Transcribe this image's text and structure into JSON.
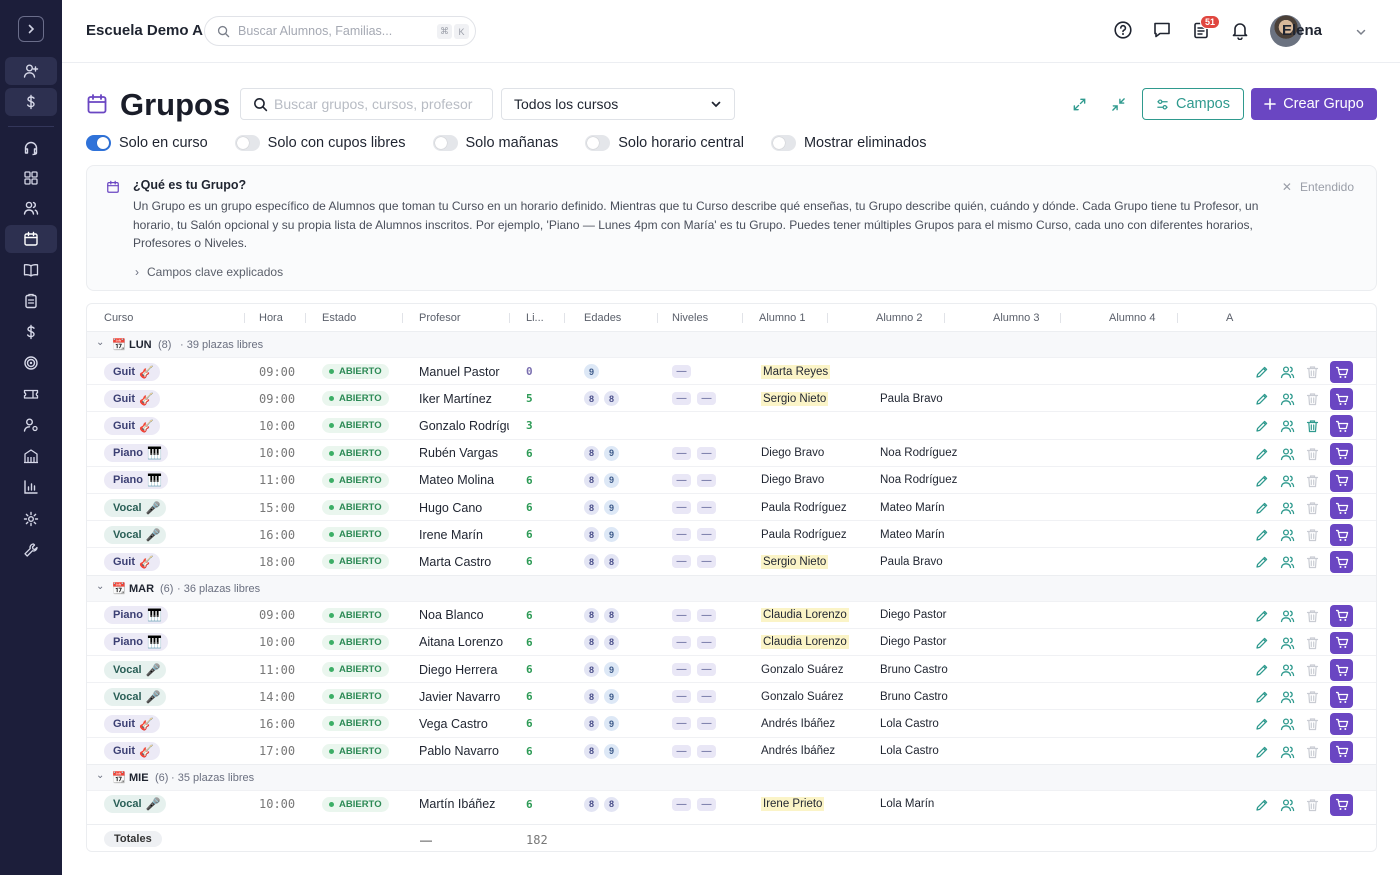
{
  "app": {
    "school": "Escuela Demo A",
    "search_placeholder": "Buscar Alumnos, Familias...",
    "kbd1": "⌘",
    "kbd2": "K",
    "notif_count": "51",
    "user": "Elena"
  },
  "page": {
    "title": "Grupos",
    "search_placeholder": "Buscar grupos, cursos, profesor",
    "course_filter": "Todos los cursos",
    "fields_button": "Campos",
    "create_button": "Crear Grupo"
  },
  "toggles": [
    {
      "label": "Solo en curso",
      "on": true
    },
    {
      "label": "Solo con cupos libres",
      "on": false
    },
    {
      "label": "Solo mañanas",
      "on": false
    },
    {
      "label": "Solo horario central",
      "on": false
    },
    {
      "label": "Mostrar eliminados",
      "on": false
    }
  ],
  "info": {
    "title": "¿Qué es tu Grupo?",
    "body": "Un Grupo es un grupo específico de Alumnos que toman tu Curso en un horario definido. Mientras que tu Curso describe qué enseñas, tu Grupo describe quién, cuándo y dónde. Cada Grupo tiene tu Profesor, un horario, tu Salón opcional y su propia lista de Alumnos inscritos. Por ejemplo, 'Piano — Lunes 4pm con María' es tu Grupo. Puedes tener múltiples Grupos para el mismo Curso, cada uno con diferentes horarios, Profesores o Niveles.",
    "link": "Campos clave explicados",
    "dismiss": "Entendido"
  },
  "columns": [
    "Curso",
    "Hora",
    "Estado",
    "Profesor",
    "Li...",
    "Edades",
    "Niveles",
    "Alumno 1",
    "Alumno 2",
    "Alumno 3",
    "Alumno 4",
    "A"
  ],
  "groups": [
    {
      "day": "LUN",
      "count": "(8)",
      "free": "· 39 plazas libres",
      "rows": [
        {
          "course": "Guit",
          "emoji": "🎸",
          "kind": "guit",
          "time": "09:00",
          "status": "ABIERTO",
          "teacher": "Manuel Pastor",
          "free": "0",
          "ages": [
            "9"
          ],
          "levels": 1,
          "s1": "Marta Reyes",
          "s1hl": true,
          "s2": "",
          "trash": false
        },
        {
          "course": "Guit",
          "emoji": "🎸",
          "kind": "guit",
          "time": "09:00",
          "status": "ABIERTO",
          "teacher": "Iker Martínez",
          "free": "5",
          "ages": [
            "8",
            "8"
          ],
          "levels": 2,
          "s1": "Sergio Nieto",
          "s1hl": true,
          "s2": "Paula Bravo",
          "trash": false
        },
        {
          "course": "Guit",
          "emoji": "🎸",
          "kind": "guit",
          "time": "10:00",
          "status": "ABIERTO",
          "teacher": "Gonzalo Rodríguez",
          "free": "3",
          "ages": [],
          "levels": 0,
          "s1": "",
          "s1hl": false,
          "s2": "",
          "trash": true
        },
        {
          "course": "Piano",
          "emoji": "🎹",
          "kind": "piano",
          "time": "10:00",
          "status": "ABIERTO",
          "teacher": "Rubén Vargas",
          "free": "6",
          "ages": [
            "8",
            "9"
          ],
          "levels": 2,
          "s1": "Diego Bravo",
          "s1hl": false,
          "s2": "Noa Rodríguez",
          "trash": false
        },
        {
          "course": "Piano",
          "emoji": "🎹",
          "kind": "piano",
          "time": "11:00",
          "status": "ABIERTO",
          "teacher": "Mateo Molina",
          "free": "6",
          "ages": [
            "8",
            "9"
          ],
          "levels": 2,
          "s1": "Diego Bravo",
          "s1hl": false,
          "s2": "Noa Rodríguez",
          "trash": false
        },
        {
          "course": "Vocal",
          "emoji": "🎤",
          "kind": "vocal",
          "time": "15:00",
          "status": "ABIERTO",
          "teacher": "Hugo Cano",
          "free": "6",
          "ages": [
            "8",
            "9"
          ],
          "levels": 2,
          "s1": "Paula Rodríguez",
          "s1hl": false,
          "s2": "Mateo Marín",
          "trash": false
        },
        {
          "course": "Vocal",
          "emoji": "🎤",
          "kind": "vocal",
          "time": "16:00",
          "status": "ABIERTO",
          "teacher": "Irene Marín",
          "free": "6",
          "ages": [
            "8",
            "9"
          ],
          "levels": 2,
          "s1": "Paula Rodríguez",
          "s1hl": false,
          "s2": "Mateo Marín",
          "trash": false
        },
        {
          "course": "Guit",
          "emoji": "🎸",
          "kind": "guit",
          "time": "18:00",
          "status": "ABIERTO",
          "teacher": "Marta Castro",
          "free": "6",
          "ages": [
            "8",
            "8"
          ],
          "levels": 2,
          "s1": "Sergio Nieto",
          "s1hl": true,
          "s2": "Paula Bravo",
          "trash": false
        }
      ]
    },
    {
      "day": "MAR",
      "count": "(6)",
      "free": "· 36 plazas libres",
      "rows": [
        {
          "course": "Piano",
          "emoji": "🎹",
          "kind": "piano",
          "time": "09:00",
          "status": "ABIERTO",
          "teacher": "Noa Blanco",
          "free": "6",
          "ages": [
            "8",
            "8"
          ],
          "levels": 2,
          "s1": "Claudia Lorenzo",
          "s1hl": true,
          "s2": "Diego Pastor",
          "trash": false
        },
        {
          "course": "Piano",
          "emoji": "🎹",
          "kind": "piano",
          "time": "10:00",
          "status": "ABIERTO",
          "teacher": "Aitana Lorenzo",
          "free": "6",
          "ages": [
            "8",
            "8"
          ],
          "levels": 2,
          "s1": "Claudia Lorenzo",
          "s1hl": true,
          "s2": "Diego Pastor",
          "trash": false
        },
        {
          "course": "Vocal",
          "emoji": "🎤",
          "kind": "vocal",
          "time": "11:00",
          "status": "ABIERTO",
          "teacher": "Diego Herrera",
          "free": "6",
          "ages": [
            "8",
            "9"
          ],
          "levels": 2,
          "s1": "Gonzalo Suárez",
          "s1hl": false,
          "s2": "Bruno Castro",
          "trash": false
        },
        {
          "course": "Vocal",
          "emoji": "🎤",
          "kind": "vocal",
          "time": "14:00",
          "status": "ABIERTO",
          "teacher": "Javier Navarro",
          "free": "6",
          "ages": [
            "8",
            "9"
          ],
          "levels": 2,
          "s1": "Gonzalo Suárez",
          "s1hl": false,
          "s2": "Bruno Castro",
          "trash": false
        },
        {
          "course": "Guit",
          "emoji": "🎸",
          "kind": "guit",
          "time": "16:00",
          "status": "ABIERTO",
          "teacher": "Vega Castro",
          "free": "6",
          "ages": [
            "8",
            "9"
          ],
          "levels": 2,
          "s1": "Andrés Ibáñez",
          "s1hl": false,
          "s2": "Lola Castro",
          "trash": false
        },
        {
          "course": "Guit",
          "emoji": "🎸",
          "kind": "guit",
          "time": "17:00",
          "status": "ABIERTO",
          "teacher": "Pablo Navarro",
          "free": "6",
          "ages": [
            "8",
            "9"
          ],
          "levels": 2,
          "s1": "Andrés Ibáñez",
          "s1hl": false,
          "s2": "Lola Castro",
          "trash": false
        }
      ]
    },
    {
      "day": "MIE",
      "count": "(6)",
      "free": "· 35 plazas libres",
      "rows": [
        {
          "course": "Vocal",
          "emoji": "🎤",
          "kind": "vocal",
          "time": "10:00",
          "status": "ABIERTO",
          "teacher": "Martín Ibáñez",
          "free": "6",
          "ages": [
            "8",
            "8"
          ],
          "levels": 2,
          "s1": "Irene Prieto",
          "s1hl": true,
          "s2": "Lola Marín",
          "trash": false
        }
      ]
    }
  ],
  "totals": {
    "label": "Totales",
    "teacher": "—",
    "free": "182"
  },
  "level_placeholder": "—",
  "colors": {
    "sidebar": "#1c1e3a",
    "primary": "#6a46c2",
    "teal": "#2f9a8e",
    "toggle_on": "#2f72d9",
    "badge": "#e0463f"
  }
}
